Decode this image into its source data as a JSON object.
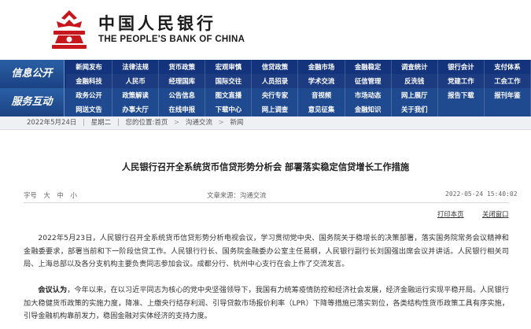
{
  "header": {
    "logo_cn": "中国人民银行",
    "logo_en": "THE PEOPLE'S BANK OF CHINA",
    "emblem_color": "#c8161d"
  },
  "nav": {
    "info_heading": "信息公开",
    "service_heading": "服务互动",
    "info_items": [
      "新闻发布",
      "法律法规",
      "货币政策",
      "宏观审慎",
      "信贷政策",
      "金融市场",
      "金融稳定",
      "调查统计",
      "银行会计",
      "支付体系",
      "金融科技",
      "人民币",
      "经理国库",
      "国际交往",
      "人员招录",
      "学术交流",
      "征信管理",
      "反洗钱",
      "党建工作",
      "工会工作"
    ],
    "service_items": [
      "政务公开",
      "政策解读",
      "公告信息",
      "图文直播",
      "央行专家",
      "音视频",
      "市场动态",
      "网上展厅",
      "报告下载",
      "报刊年鉴",
      "网送文告",
      "办事大厅",
      "在线申报",
      "下载中心",
      "网上调查",
      "意见征集",
      "金融知识",
      "关于我们",
      "",
      ""
    ],
    "colors": {
      "info_bg": "#13347c",
      "service_bg": "#1f4a90"
    }
  },
  "breadcrumb": {
    "date": "2022年5月24日",
    "weekday": "星期二",
    "prefix": "您的位置:",
    "home": "首页",
    "section": "沟通交流",
    "page": "新闻"
  },
  "article": {
    "title": "人民银行召开全系统货币信贷形势分析会  部署落实稳定信贷增长工作措施",
    "fontsize_label": "字号",
    "size_large": "大",
    "size_medium": "中",
    "size_small": "小",
    "source": "文章来源：沟通交流",
    "datetime": "2022-05-24 15:40:02",
    "print_label": "打印本页",
    "close_label": "关闭窗口",
    "para1": "2022年5月23日，人民银行召开全系统货币信贷形势分析电视会议，学习贯彻党中央、国务院关于稳增长的决策部署，落实国务院常务会议精神和金融委要求，部署当前和下一阶段信贷工作。人民银行行长、国务院金融委办公室主任易纲，人民银行副行长刘国强出席会议并讲话。人民银行相关司局、上海总部以及各分支机构主要负责同志参加会议。成都分行、杭州中心支行在会上作了交流发言。",
    "para2_lead": "会议认为",
    "para2": "，今年以来，在以习近平同志为核心的党中央坚强领导下，我国有力统筹疫情防控和经济社会发展，经济金融运行实现平稳开局。人民银行加大稳健货币政策的实施力度，降准、上缴央行结存利润、引导贷款市场报价利率（LPR）下降等措施已落实到位，各类结构性货币政策工具有序实施，引导金融机构靠前发力，稳固金融对实体经济的支持力度。"
  }
}
